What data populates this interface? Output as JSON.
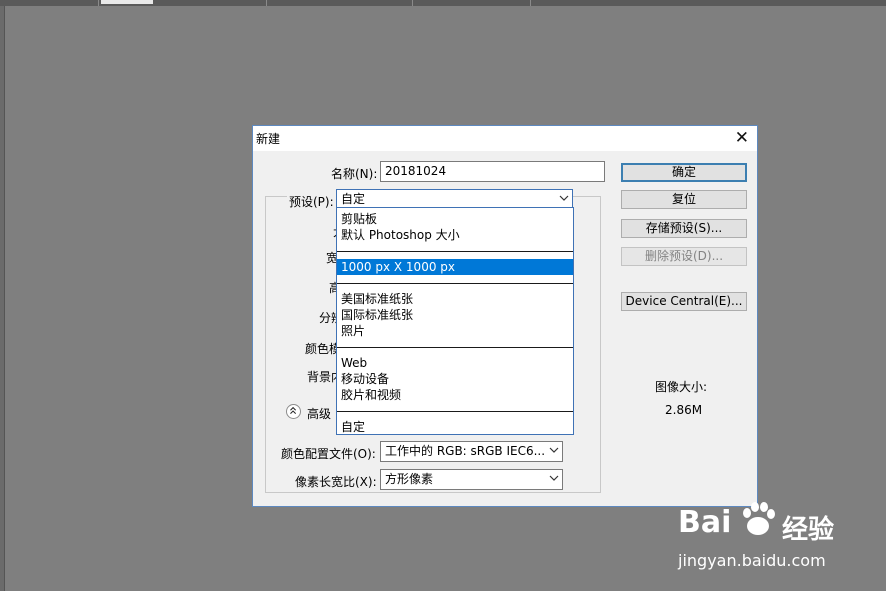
{
  "dialog": {
    "title": "新建",
    "name_label": "名称(N):",
    "name_value": "20181024",
    "preset_label": "预设(P):",
    "preset_value": "自定",
    "partial_labels": {
      "size": "大",
      "width": "宽",
      "height": "高",
      "resolution": "分辨",
      "color_mode": "颜色模",
      "background": "背景内"
    },
    "advanced_label": "高级",
    "color_profile_label": "颜色配置文件(O):",
    "color_profile_value": "工作中的 RGB: sRGB IEC6...",
    "pixel_aspect_label": "像素长宽比(X):",
    "pixel_aspect_value": "方形像素",
    "image_size_label": "图像大小:",
    "image_size_value": "2.86M"
  },
  "buttons": {
    "ok": "确定",
    "reset": "复位",
    "save_preset": "存储预设(S)...",
    "delete_preset": "删除预设(D)...",
    "device_central": "Device Central(E)..."
  },
  "preset_menu": {
    "group1": [
      "剪贴板",
      "默认 Photoshop 大小"
    ],
    "group2": [
      "1000 px X 1000 px"
    ],
    "group3": [
      "美国标准纸张",
      "国际标准纸张",
      "照片"
    ],
    "group4": [
      "Web",
      "移动设备",
      "胶片和视频"
    ],
    "group5": [
      "自定"
    ],
    "selected": "1000 px X 1000 px"
  },
  "watermark": {
    "brand_left": "Bai",
    "brand_right": "经验",
    "url": "jingyan.baidu.com"
  },
  "colors": {
    "background": "#7f7f7f",
    "dialog": "#f0f0f0",
    "selection": "#0078d7",
    "default_button_border": "#3c7fb1"
  }
}
